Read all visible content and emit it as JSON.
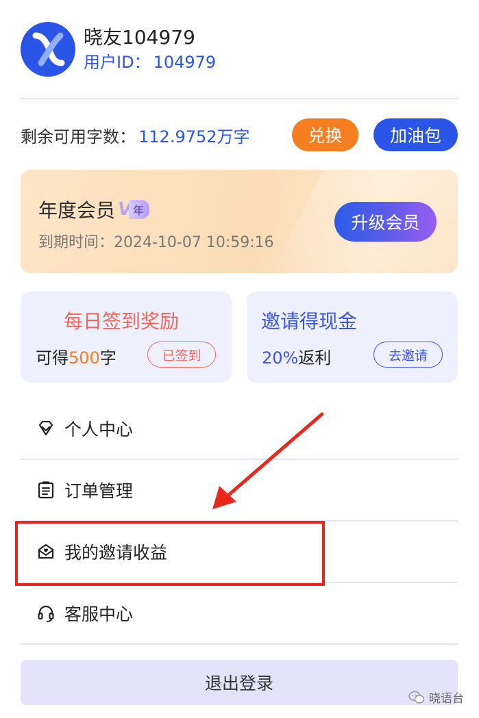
{
  "user": {
    "name": "晓友104979",
    "id_label": "用户ID：",
    "id_value": "104979"
  },
  "balance": {
    "label": "剩余可用字数：",
    "value": "112.9752万字",
    "exchange_label": "兑换",
    "boost_label": "加油包"
  },
  "membership": {
    "title": "年度会员",
    "badge_v": "V",
    "badge_text": "年",
    "expire_text": "到期时间：2024-10-07 10:59:16",
    "upgrade_label": "升级会员"
  },
  "checkin": {
    "title": "每日签到奖励",
    "prefix": "可得",
    "amount": "500",
    "suffix": "字",
    "status_label": "已签到"
  },
  "invite": {
    "title": "邀请得现金",
    "rate": "20%",
    "suffix": "返利",
    "action_label": "去邀请"
  },
  "menu": [
    {
      "label": "个人中心",
      "icon": "diamond-icon"
    },
    {
      "label": "订单管理",
      "icon": "clipboard-icon"
    },
    {
      "label": "我的邀请收益",
      "icon": "envelope-heart-icon"
    },
    {
      "label": "客服中心",
      "icon": "headset-icon"
    }
  ],
  "logout_label": "退出登录",
  "watermark": "晓语台",
  "colors": {
    "primary": "#2b55e6",
    "orange": "#f57e21",
    "coral": "#f2675b",
    "annotation_red": "#e8281d"
  }
}
